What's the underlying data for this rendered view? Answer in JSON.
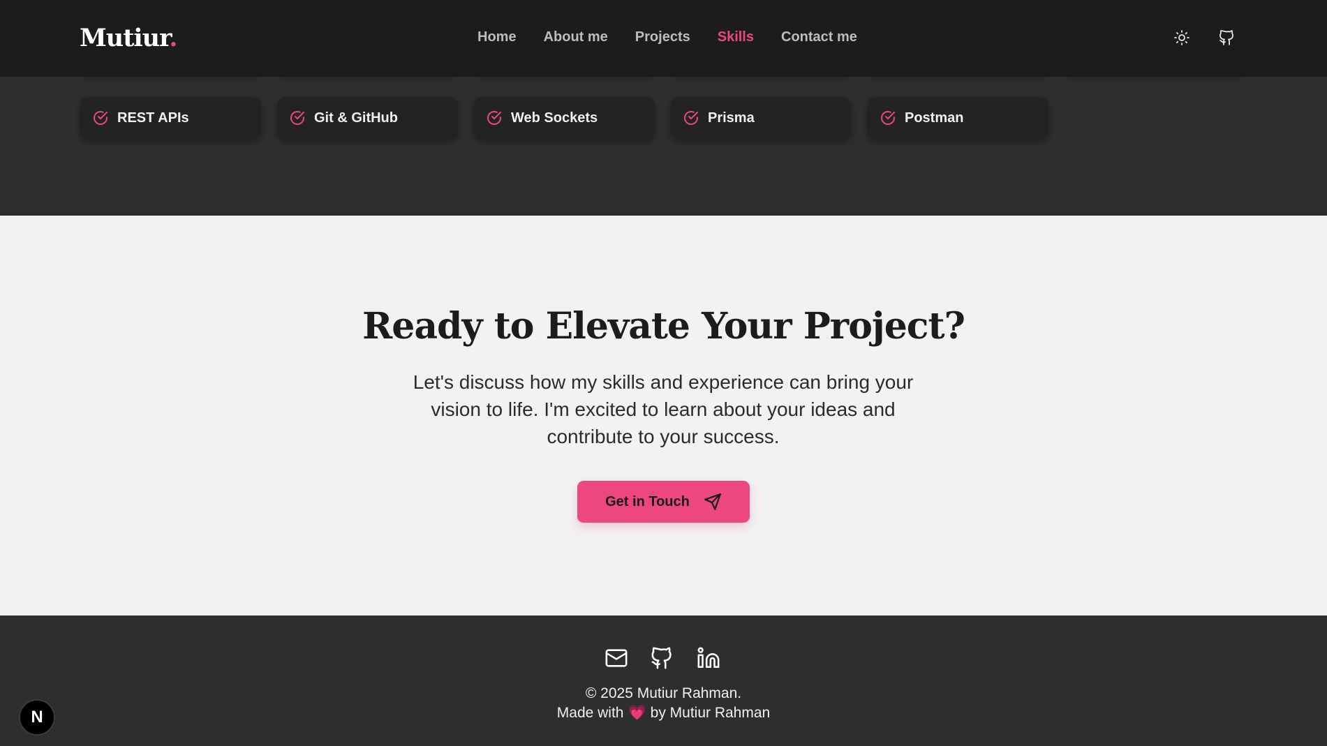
{
  "header": {
    "logo": "Mutiur",
    "logo_dot": ".",
    "nav": [
      {
        "label": "Home",
        "active": false
      },
      {
        "label": "About me",
        "active": false
      },
      {
        "label": "Projects",
        "active": false
      },
      {
        "label": "Skills",
        "active": true
      },
      {
        "label": "Contact me",
        "active": false
      }
    ],
    "icons": [
      "sun-icon",
      "github-icon"
    ]
  },
  "skills": {
    "items": [
      "REST APIs",
      "Git & GitHub",
      "Web Sockets",
      "Prisma",
      "Postman"
    ],
    "icon": "check-circle-icon"
  },
  "cta": {
    "title": "Ready to Elevate Your Project?",
    "text": "Let's discuss how my skills and experience can bring your vision to life. I'm excited to learn about your ideas and contribute to your success.",
    "button_label": "Get in Touch",
    "button_icon": "send-icon"
  },
  "footer": {
    "icons": [
      "mail-icon",
      "github-icon",
      "linkedin-icon"
    ],
    "copyright": "© 2025 Mutiur Rahman.",
    "made_prefix": "Made with",
    "heart": "💗",
    "made_suffix": "by Mutiur Rahman"
  },
  "badge": "N",
  "colors": {
    "accent": "#ec4780",
    "dark_bg": "#2e2e2e",
    "light_bg": "#f2f2f2"
  }
}
